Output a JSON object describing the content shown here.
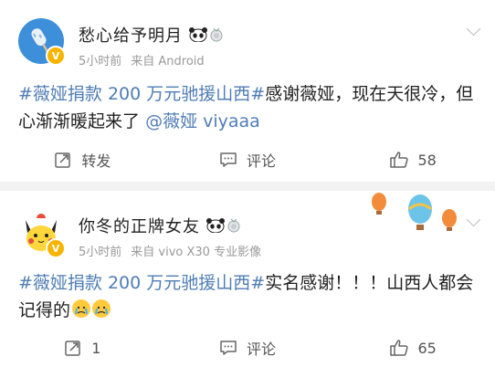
{
  "posts": [
    {
      "user": "愁心给予明月",
      "time": "5小时前",
      "source": "来自 Android",
      "content": {
        "topic": "#薇娅捐款 200 万元驰援山西#",
        "text": "感谢薇娅，现在天很冷，但心渐渐暖起来了",
        "mention": "@薇娅 viyaaa"
      },
      "actions": {
        "repost": "转发",
        "comment": "评论",
        "likes": "58"
      }
    },
    {
      "user": "你冬的正牌女友",
      "time": "5小时前",
      "source": "来自 vivo X30 专业影像",
      "content": {
        "topic": "#薇娅捐款 200 万元驰援山西#",
        "text": "实名感谢！！！山西人都会记得的"
      },
      "actions": {
        "repost": "1",
        "comment": "评论",
        "likes": "65"
      }
    }
  ],
  "colors": {
    "link": "#4f7db4",
    "verified": "#f7b500",
    "meta": "#999999"
  }
}
